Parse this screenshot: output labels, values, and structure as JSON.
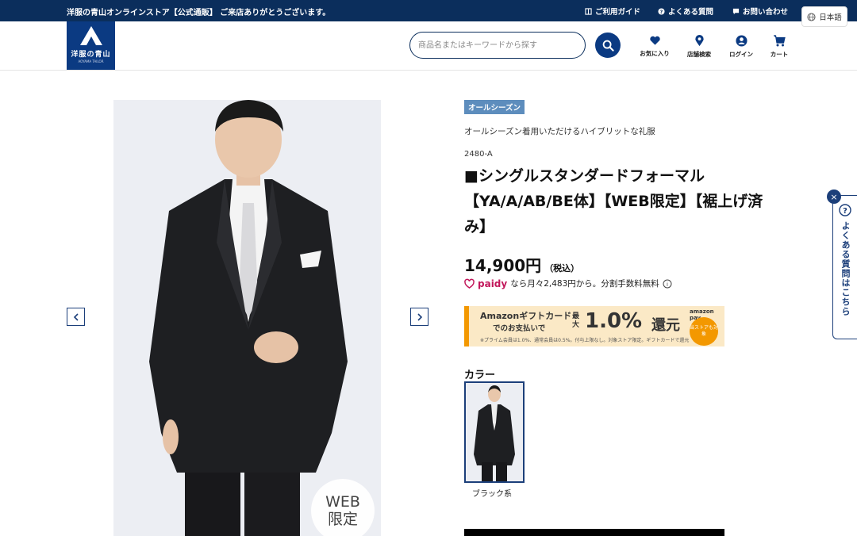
{
  "topbar": {
    "message": "洋服の青山オンラインストア【公式通販】 ご来店ありがとうございます。",
    "links": [
      "ご利用ガイド",
      "よくある質問",
      "お問い合わせ"
    ],
    "language": "日本語"
  },
  "header": {
    "logo_text": "洋服の青山",
    "logo_sub": "AOYAMA TAILOR",
    "search_placeholder": "商品名またはキーワードから探す",
    "nav": [
      "お気に入り",
      "店舗検索",
      "ログイン",
      "カート"
    ]
  },
  "product": {
    "tag": "オールシーズン",
    "subtitle": "オールシーズン着用いただけるハイブリットな礼服",
    "code": "2480-A",
    "title": "■シングルスタンダードフォーマル【YA/A/AB/BE体】【WEB限定】【裾上げ済み】",
    "price": "14,900円",
    "tax": "（税込）",
    "paidy_logo": "paidy",
    "paidy_text": "なら月々2,483円から。分割手数料無料",
    "badge_web": "WEB",
    "badge_limited": "限定"
  },
  "amazon": {
    "line1": "Amazonギフトカード",
    "line2": "でのお支払いで",
    "max": "最大",
    "rate": "1.0%",
    "back": "還元",
    "logo": "amazon pay",
    "circle": "当ストアも対象",
    "note": "※プライム会員は1.0%、通常会員は0.5%。付与上限なし。対象ストア限定。ギフトカードで還元"
  },
  "color": {
    "label": "カラー",
    "options": [
      "ブラック系"
    ]
  },
  "faq": {
    "label": "よくある質問はこちら",
    "close": "×"
  },
  "colors": {
    "navy": "#0b2e5c",
    "accent_tag": "#5d8dbd",
    "amazon_bg": "#fbe9c6",
    "amazon_orange": "#f39800",
    "paidy": "#c2185b"
  }
}
